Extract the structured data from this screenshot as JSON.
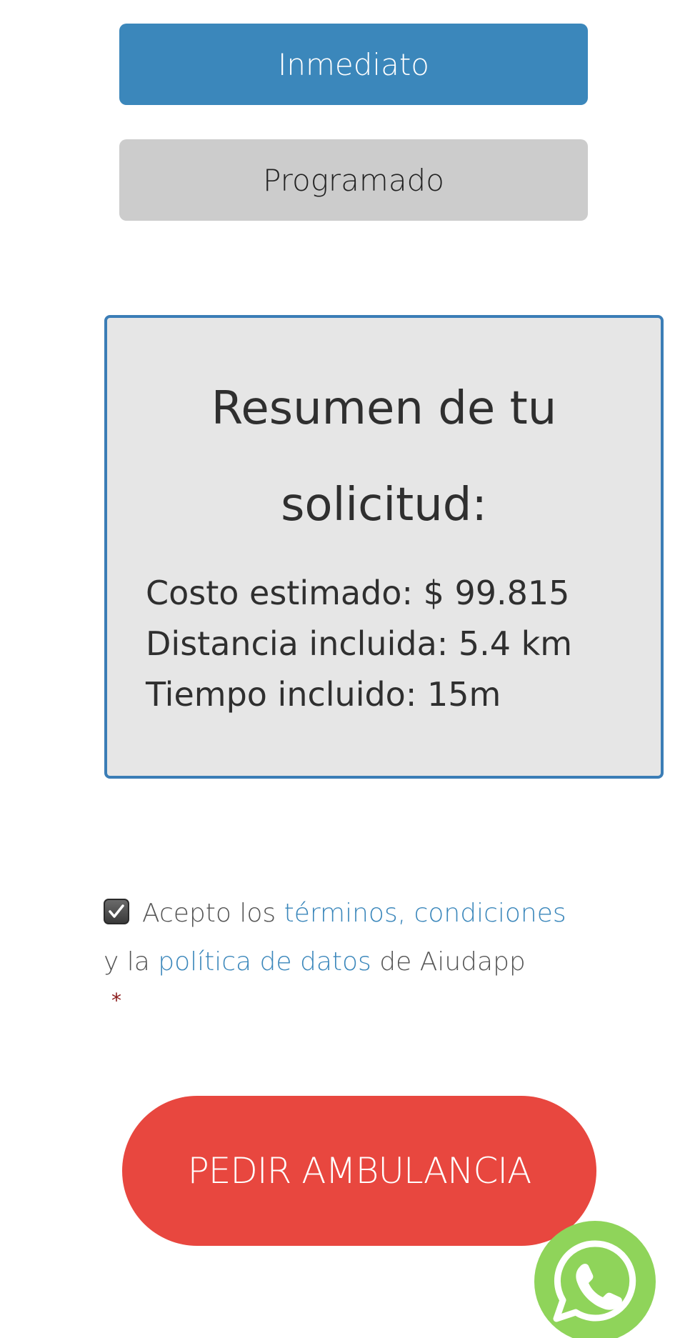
{
  "mode_buttons": {
    "immediate_label": "Inmediato",
    "scheduled_label": "Programado"
  },
  "summary": {
    "title": "Resumen de tu solicitud:",
    "cost_label": "Costo estimado:",
    "cost_value": "$ 99.815",
    "distance_label": "Distancia incluida:",
    "distance_value": "5.4 km",
    "time_label": "Tiempo incluido:",
    "time_value": "15m"
  },
  "terms": {
    "checked": true,
    "prefix": "Acepto los",
    "terms_link": "términos, condiciones",
    "middle": "y la",
    "privacy_link": "política de datos",
    "suffix": "de Aiudapp",
    "required_mark": "*"
  },
  "cta": {
    "label": "PEDIR AMBULANCIA"
  },
  "floating": {
    "icon": "whatsapp-icon"
  },
  "colors": {
    "primary_blue": "#3b87bb",
    "cta_red": "#e8473f",
    "whatsapp_green": "#8fd45a"
  }
}
